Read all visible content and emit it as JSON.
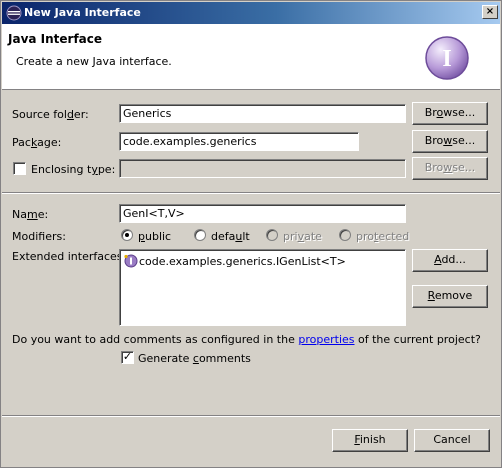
{
  "window": {
    "title": "New Java Interface",
    "close_glyph": "×"
  },
  "header": {
    "title": "Java Interface",
    "description": "Create a new Java interface.",
    "icon": "interface-icon",
    "icon_letter": "I"
  },
  "form": {
    "source_folder": {
      "label_pre": "Source fol",
      "label_key": "d",
      "label_post": "er:",
      "value": "Generics",
      "browse_pre": "Br",
      "browse_key": "o",
      "browse_post": "wse..."
    },
    "package": {
      "label_pre": "Pac",
      "label_key": "k",
      "label_post": "age:",
      "value": "code.examples.generics",
      "browse_pre": "Bro",
      "browse_key": "w",
      "browse_post": "se..."
    },
    "enclosing_type": {
      "label_pre": "Enclosing t",
      "label_key": "y",
      "label_post": "pe:",
      "checked": false,
      "value": "",
      "browse_pre": "Bro",
      "browse_key": "w",
      "browse_post": "se..."
    },
    "name": {
      "label_pre": "Na",
      "label_key": "m",
      "label_post": "e:",
      "value": "GenI<T,V>"
    },
    "modifiers": {
      "label": "Modifiers:",
      "options": [
        {
          "pre": "",
          "key": "p",
          "post": "ublic",
          "selected": true,
          "disabled": false
        },
        {
          "pre": "defa",
          "key": "u",
          "post": "lt",
          "selected": false,
          "disabled": false
        },
        {
          "pre": "pri",
          "key": "v",
          "post": "ate",
          "selected": false,
          "disabled": true
        },
        {
          "pre": "pro",
          "key": "t",
          "post": "ected",
          "selected": false,
          "disabled": true
        }
      ]
    },
    "extended_interfaces": {
      "label": "Extended interfaces:",
      "items": [
        {
          "text": "code.examples.generics.IGenList<T>",
          "icon": "interface-icon"
        }
      ],
      "add_pre": "",
      "add_key": "A",
      "add_post": "dd...",
      "remove_pre": "",
      "remove_key": "R",
      "remove_post": "emove"
    },
    "comments": {
      "question_pre": "Do you want to add comments as configured in the ",
      "question_link": "properties",
      "question_post": " of the current project?",
      "generate_pre": "Generate ",
      "generate_key": "c",
      "generate_post": "omments",
      "checked": true,
      "check_glyph": "✓"
    }
  },
  "footer": {
    "finish_pre": "",
    "finish_key": "F",
    "finish_post": "inish",
    "cancel": "Cancel"
  }
}
